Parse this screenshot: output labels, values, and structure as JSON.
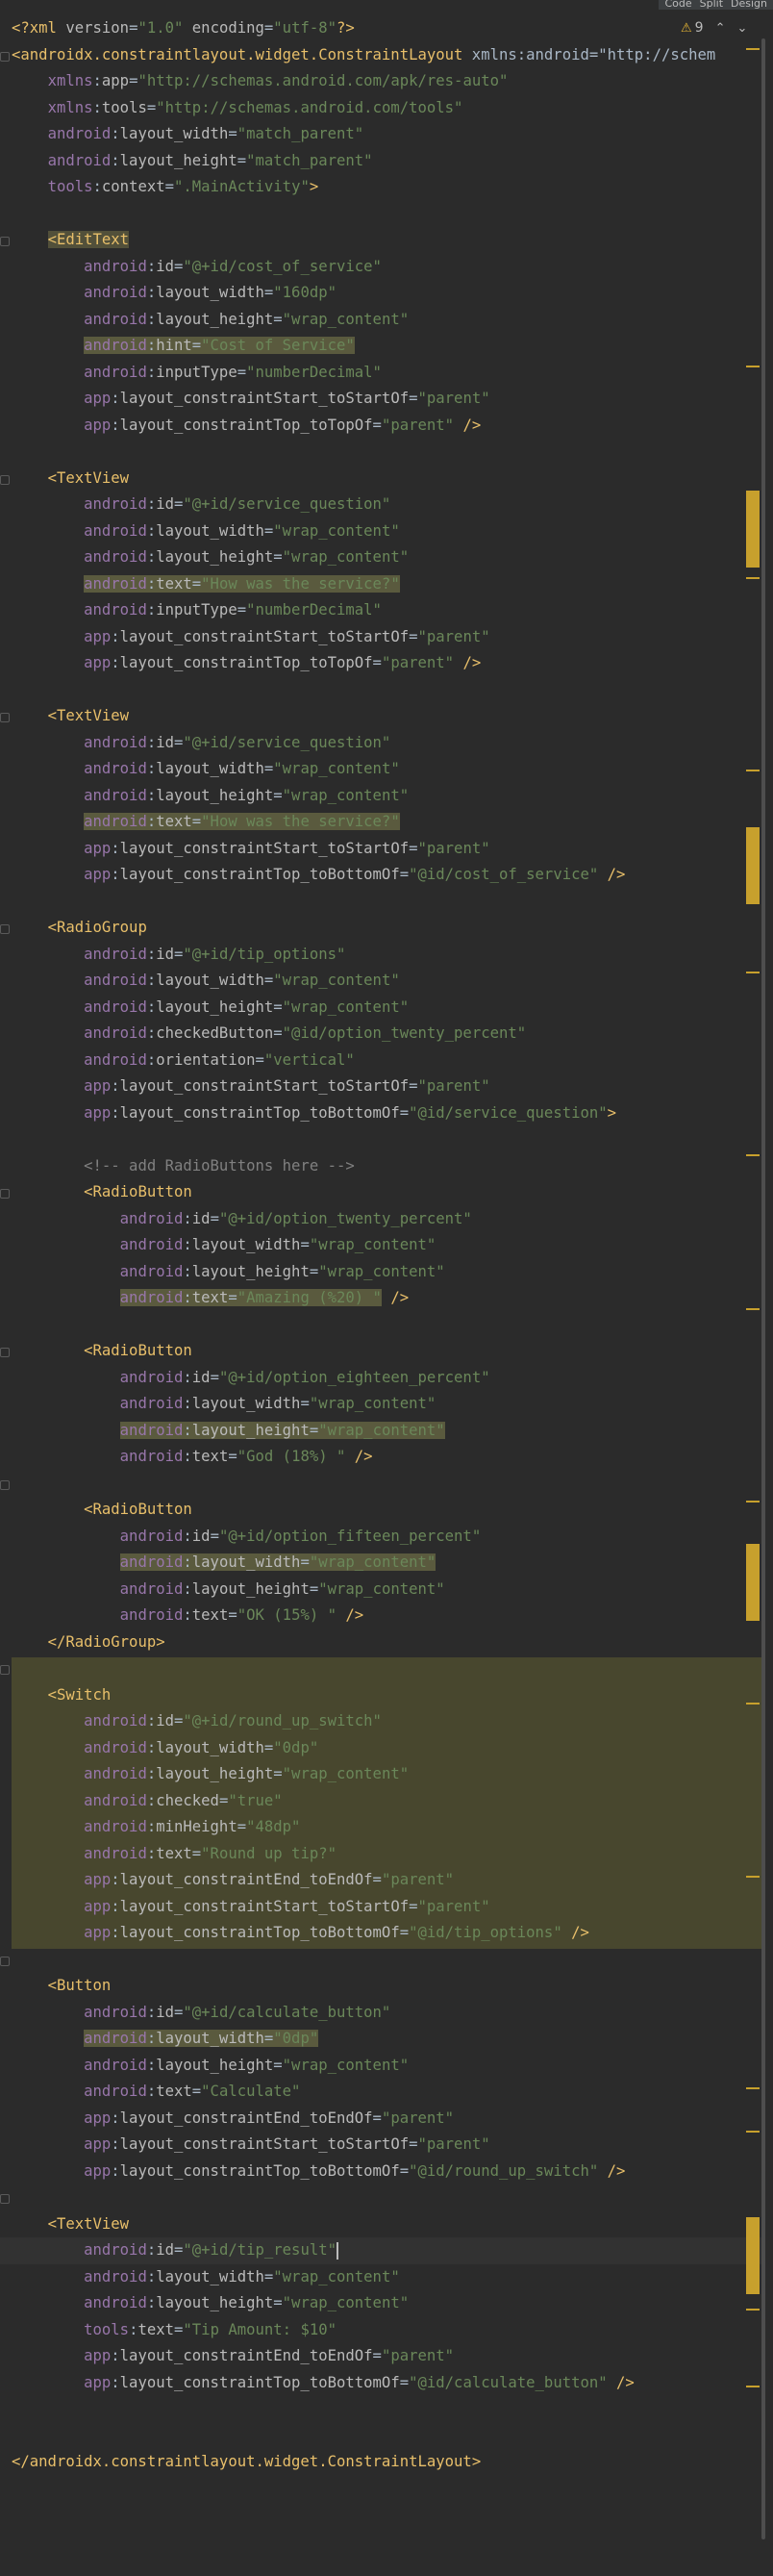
{
  "view_switch": {
    "code": "Code",
    "split": "Split",
    "design": "Design"
  },
  "inspection": {
    "warning_count": "9",
    "up": "^",
    "down": "v"
  },
  "code_lines": [
    "<?xml version=\"1.0\" encoding=\"utf-8\"?>",
    "<androidx.constraintlayout.widget.ConstraintLayout xmlns:android=\"http://schem",
    "    xmlns:app=\"http://schemas.android.com/apk/res-auto\"",
    "    xmlns:tools=\"http://schemas.android.com/tools\"",
    "    android:layout_width=\"match_parent\"",
    "    android:layout_height=\"match_parent\"",
    "    tools:context=\".MainActivity\">",
    "",
    "    <EditText",
    "        android:id=\"@+id/cost_of_service\"",
    "        android:layout_width=\"160dp\"",
    "        android:layout_height=\"wrap_content\"",
    "        android:hint=\"Cost of Service\"",
    "        android:inputType=\"numberDecimal\"",
    "        app:layout_constraintStart_toStartOf=\"parent\"",
    "        app:layout_constraintTop_toTopOf=\"parent\" />",
    "",
    "    <TextView",
    "        android:id=\"@+id/service_question\"",
    "        android:layout_width=\"wrap_content\"",
    "        android:layout_height=\"wrap_content\"",
    "        android:text=\"How was the service?\"",
    "        android:inputType=\"numberDecimal\"",
    "        app:layout_constraintStart_toStartOf=\"parent\"",
    "        app:layout_constraintTop_toTopOf=\"parent\" />",
    "",
    "    <TextView",
    "        android:id=\"@+id/service_question\"",
    "        android:layout_width=\"wrap_content\"",
    "        android:layout_height=\"wrap_content\"",
    "        android:text=\"How was the service?\"",
    "        app:layout_constraintStart_toStartOf=\"parent\"",
    "        app:layout_constraintTop_toBottomOf=\"@id/cost_of_service\" />",
    "",
    "    <RadioGroup",
    "        android:id=\"@+id/tip_options\"",
    "        android:layout_width=\"wrap_content\"",
    "        android:layout_height=\"wrap_content\"",
    "        android:checkedButton=\"@id/option_twenty_percent\"",
    "        android:orientation=\"vertical\"",
    "        app:layout_constraintStart_toStartOf=\"parent\"",
    "        app:layout_constraintTop_toBottomOf=\"@id/service_question\">",
    "",
    "        <!-- add RadioButtons here -->",
    "        <RadioButton",
    "            android:id=\"@+id/option_twenty_percent\"",
    "            android:layout_width=\"wrap_content\"",
    "            android:layout_height=\"wrap_content\"",
    "            android:text=\"Amazing (%20) \" />",
    "",
    "        <RadioButton",
    "            android:id=\"@+id/option_eighteen_percent\"",
    "            android:layout_width=\"wrap_content\"",
    "            android:layout_height=\"wrap_content\"",
    "            android:text=\"God (18%) \" />",
    "",
    "        <RadioButton",
    "            android:id=\"@+id/option_fifteen_percent\"",
    "            android:layout_width=\"wrap_content\"",
    "            android:layout_height=\"wrap_content\"",
    "            android:text=\"OK (15%) \" />",
    "    </RadioGroup>",
    "",
    "    <Switch",
    "        android:id=\"@+id/round_up_switch\"",
    "        android:layout_width=\"0dp\"",
    "        android:layout_height=\"wrap_content\"",
    "        android:checked=\"true\"",
    "        android:minHeight=\"48dp\"",
    "        android:text=\"Round up tip?\"",
    "        app:layout_constraintEnd_toEndOf=\"parent\"",
    "        app:layout_constraintStart_toStartOf=\"parent\"",
    "        app:layout_constraintTop_toBottomOf=\"@id/tip_options\" />",
    "",
    "    <Button",
    "        android:id=\"@+id/calculate_button\"",
    "        android:layout_width=\"0dp\"",
    "        android:layout_height=\"wrap_content\"",
    "        android:text=\"Calculate\"",
    "        app:layout_constraintEnd_toEndOf=\"parent\"",
    "        app:layout_constraintStart_toStartOf=\"parent\"",
    "        app:layout_constraintTop_toBottomOf=\"@id/round_up_switch\" />",
    "",
    "    <TextView",
    "        android:id=\"@+id/tip_result\"",
    "        android:layout_width=\"wrap_content\"",
    "        android:layout_height=\"wrap_content\"",
    "        tools:text=\"Tip Amount: $10\"",
    "        app:layout_constraintEnd_toEndOf=\"parent\"",
    "        app:layout_constraintTop_toBottomOf=\"@id/calculate_button\" />",
    "",
    "",
    "</androidx.constraintlayout.widget.ConstraintLayout>"
  ],
  "colors": {
    "background": "#2b2b2b",
    "tag": "#e8bf6a",
    "namespace": "#9876aa",
    "attribute": "#bababa",
    "value": "#6a8759",
    "comment": "#808080",
    "warning": "#c7a02d"
  }
}
